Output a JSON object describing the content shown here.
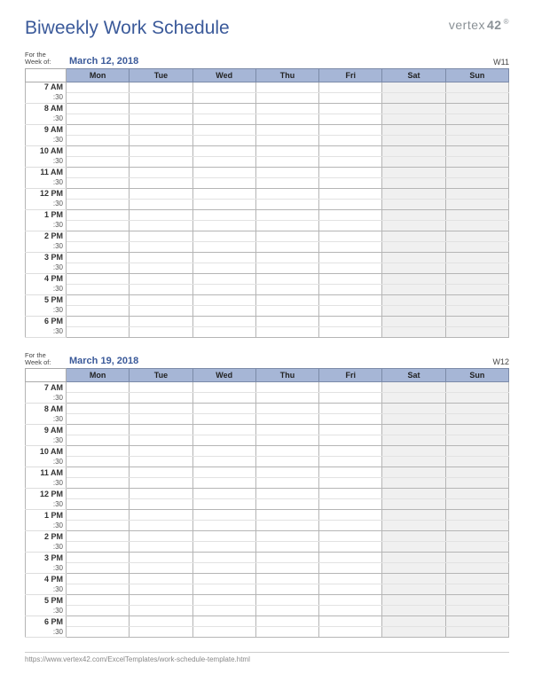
{
  "title": "Biweekly Work Schedule",
  "logo": {
    "text": "vertex",
    "suffix": "42",
    "reg": "®"
  },
  "days": [
    "Mon",
    "Tue",
    "Wed",
    "Thu",
    "Fri",
    "Sat",
    "Sun"
  ],
  "hours": [
    "7 AM",
    "8 AM",
    "9 AM",
    "10 AM",
    "11 AM",
    "12 PM",
    "1 PM",
    "2 PM",
    "3 PM",
    "4 PM",
    "5 PM",
    "6 PM"
  ],
  "half_label": ":30",
  "meta_label_line1": "For the",
  "meta_label_line2": "Week of:",
  "weeks": [
    {
      "date": "March 12, 2018",
      "week_num": "W11"
    },
    {
      "date": "March 19, 2018",
      "week_num": "W12"
    }
  ],
  "footer_url": "https://www.vertex42.com/ExcelTemplates/work-schedule-template.html"
}
